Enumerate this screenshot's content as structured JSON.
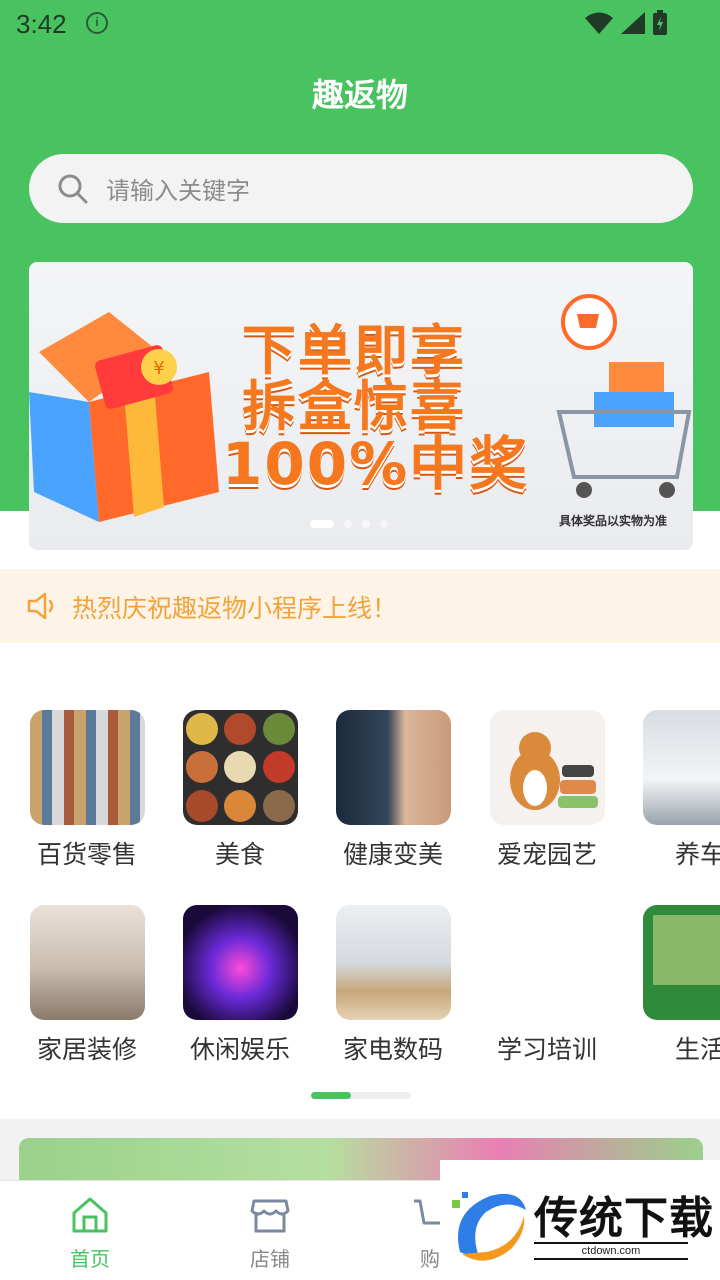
{
  "status": {
    "time": "3:42"
  },
  "header": {
    "title": "趣返物"
  },
  "search": {
    "placeholder": "请输入关键字"
  },
  "banner": {
    "line1": "下单即享",
    "line2": "拆盒惊喜",
    "line3": "100%中奖",
    "note": "具体奖品以实物为准",
    "slide_count": 5,
    "active_slide": 1
  },
  "notice": {
    "text": "热烈庆祝趣返物小程序上线！"
  },
  "categories": [
    {
      "label": "百货零售"
    },
    {
      "label": "美食"
    },
    {
      "label": "健康变美"
    },
    {
      "label": "爱宠园艺"
    },
    {
      "label": "养车"
    },
    {
      "label": "家居装修"
    },
    {
      "label": "休闲娱乐"
    },
    {
      "label": "家电数码"
    },
    {
      "label": "学习培训"
    },
    {
      "label": "生活"
    }
  ],
  "category_page": {
    "current": 1,
    "total": 2
  },
  "tabbar": {
    "items": [
      {
        "label": "首页",
        "icon": "home-icon",
        "active": true
      },
      {
        "label": "店铺",
        "icon": "store-icon",
        "active": false
      },
      {
        "label": "购",
        "icon": "cart-icon",
        "active": false
      }
    ]
  },
  "watermark": {
    "brand": "传统下载",
    "url": "ctdown.com"
  },
  "colors": {
    "primary": "#48c35f",
    "notice_text": "#f2a33a",
    "notice_bg": "#fdf3e7"
  }
}
